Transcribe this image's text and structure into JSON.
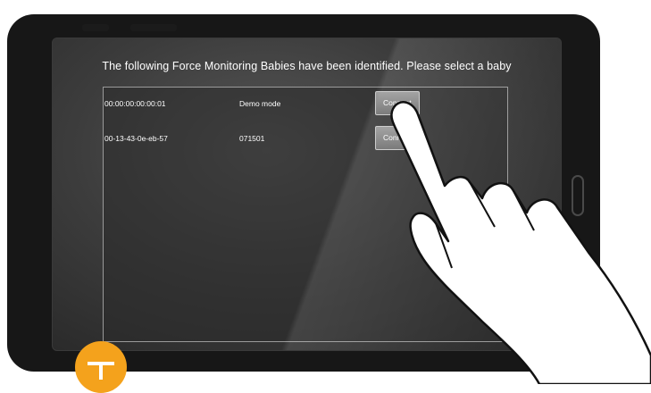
{
  "screen": {
    "title": "The following Force Monitoring Babies have been identified. Please select a baby"
  },
  "devices": [
    {
      "id": "00:00:00:00:00:01",
      "name": "Demo mode",
      "button_label": "Connect"
    },
    {
      "id": "00-13-43-0e-eb-57",
      "name": "071501",
      "button_label": "Connect"
    }
  ],
  "icons": {
    "badge": "t-letter-badge-icon",
    "hand": "pointing-hand-icon"
  },
  "colors": {
    "tablet_bezel": "#171717",
    "badge": "#f4a21c",
    "button": "#8a8a8a"
  }
}
